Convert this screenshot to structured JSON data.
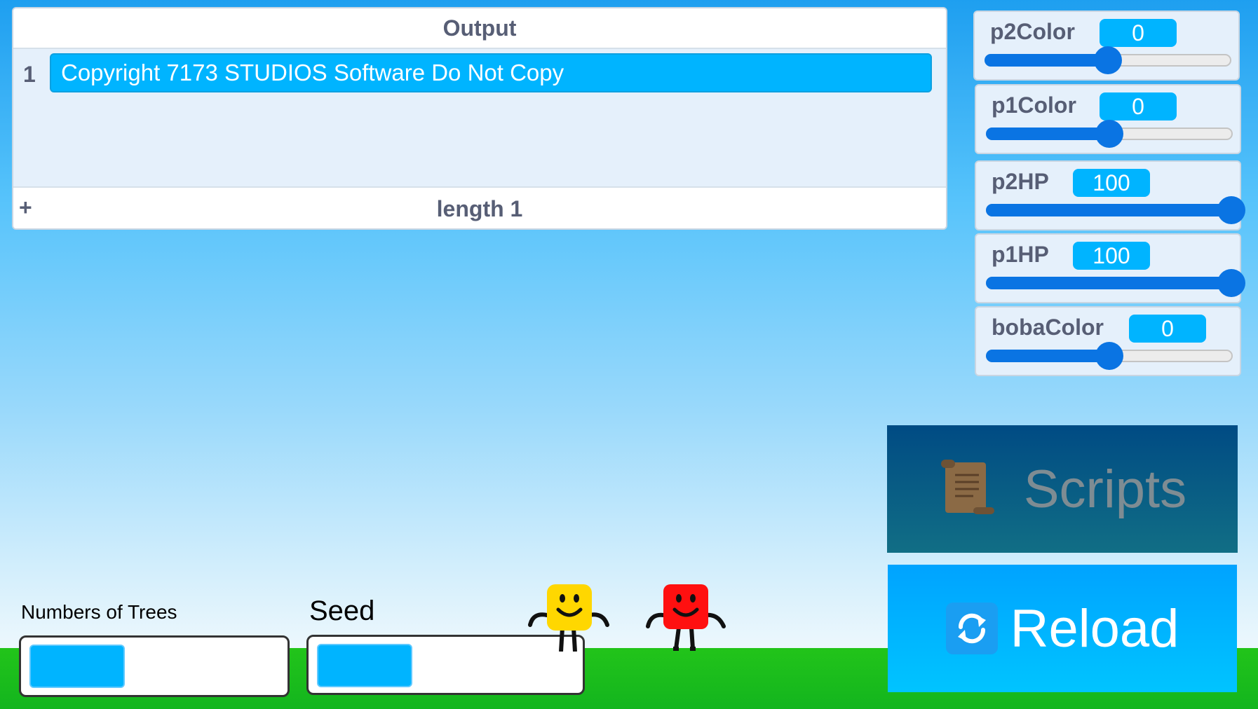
{
  "output_list": {
    "title": "Output",
    "items": [
      {
        "index": "1",
        "text": "Copyright 7173 STUDIOS Software Do Not Copy"
      }
    ],
    "add_label": "+",
    "length_label": "length 1"
  },
  "variables": [
    {
      "name": "p2Color",
      "value": "0",
      "slider_fraction": 0.5
    },
    {
      "name": "p1Color",
      "value": "0",
      "slider_fraction": 0.5
    },
    {
      "name": "p2HP",
      "value": "100",
      "slider_fraction": 1.0
    },
    {
      "name": "p1HP",
      "value": "100",
      "slider_fraction": 1.0
    },
    {
      "name": "bobaColor",
      "value": "0",
      "slider_fraction": 0.5
    }
  ],
  "buttons": {
    "scripts_label": "Scripts",
    "reload_label": "Reload",
    "scripts_icon": "scroll-icon",
    "reload_icon": "refresh-icon"
  },
  "inputs": {
    "trees_label": "Numbers of Trees",
    "seed_label": "Seed",
    "trees_value": "",
    "seed_value": ""
  },
  "sprites": [
    {
      "name": "yellow-player",
      "color": "#ffd700"
    },
    {
      "name": "red-player",
      "color": "#ff1010"
    }
  ],
  "colors": {
    "accent": "#00b4ff",
    "slider": "#0a74e3",
    "sky_top": "#1e9ff0",
    "ground": "#1fbf1c"
  }
}
